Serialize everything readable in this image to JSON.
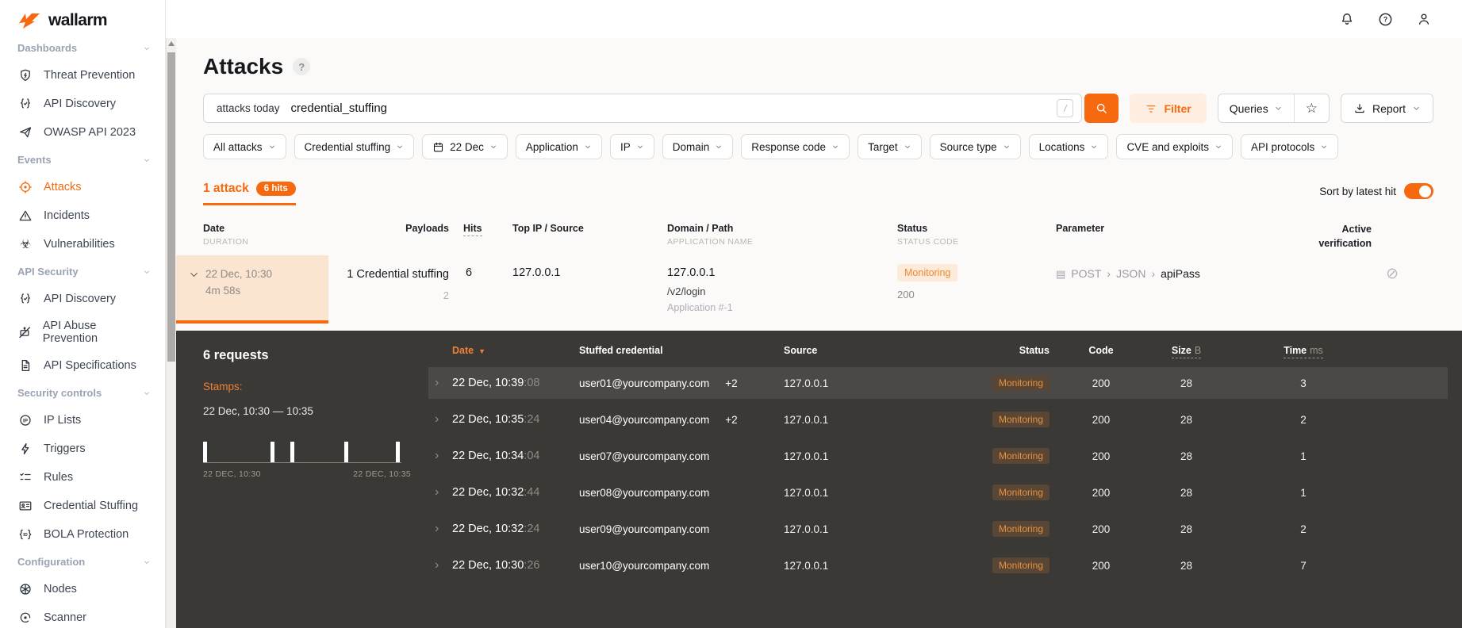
{
  "brand": {
    "name": "wallarm"
  },
  "topbar": {
    "icons": [
      "bell-icon",
      "help-icon",
      "person-icon"
    ]
  },
  "sidebar": {
    "sections": [
      {
        "label": "Dashboards",
        "items": [
          {
            "icon": "shield-icon",
            "label": "Threat Prevention"
          },
          {
            "icon": "braces-check-icon",
            "label": "API Discovery"
          },
          {
            "icon": "paper-plane-icon",
            "label": "OWASP API 2023"
          }
        ]
      },
      {
        "label": "Events",
        "items": [
          {
            "icon": "target-icon",
            "label": "Attacks"
          },
          {
            "icon": "warning-triangle-icon",
            "label": "Incidents"
          },
          {
            "icon": "biohazard-icon",
            "label": "Vulnerabilities"
          }
        ]
      },
      {
        "label": "API Security",
        "items": [
          {
            "icon": "braces-check-icon",
            "label": "API Discovery"
          },
          {
            "icon": "robot-crossed-icon",
            "label": "API Abuse Prevention"
          },
          {
            "icon": "document-icon",
            "label": "API Specifications"
          }
        ]
      },
      {
        "label": "Security controls",
        "items": [
          {
            "icon": "ip-circle-icon",
            "label": "IP Lists"
          },
          {
            "icon": "bolt-icon",
            "label": "Triggers"
          },
          {
            "icon": "checklist-icon",
            "label": "Rules"
          },
          {
            "icon": "id-card-icon",
            "label": "Credential Stuffing"
          },
          {
            "icon": "id-braces-icon",
            "label": "BOLA Protection"
          }
        ]
      },
      {
        "label": "Configuration",
        "items": [
          {
            "icon": "nodes-icon",
            "label": "Nodes"
          },
          {
            "icon": "scanner-icon",
            "label": "Scanner"
          }
        ]
      }
    ]
  },
  "page": {
    "title": "Attacks"
  },
  "search": {
    "query_primary": "attacks today",
    "query_secondary": "credential_stuffing",
    "shortcut_key": "/"
  },
  "actions": {
    "filter": "Filter",
    "queries": "Queries",
    "report": "Report"
  },
  "filters": {
    "chips": [
      {
        "label": "All attacks"
      },
      {
        "label": "Credential stuffing"
      },
      {
        "label": "22 Dec",
        "icon": "calendar-icon"
      },
      {
        "label": "Application"
      },
      {
        "label": "IP"
      },
      {
        "label": "Domain"
      },
      {
        "label": "Response code"
      },
      {
        "label": "Target"
      },
      {
        "label": "Source type"
      },
      {
        "label": "Locations"
      },
      {
        "label": "CVE and exploits"
      },
      {
        "label": "API protocols"
      }
    ]
  },
  "summary": {
    "attacks": "1 attack",
    "hits": "6 hits",
    "sort_label": "Sort by latest hit",
    "sort_on": true
  },
  "attacks_table": {
    "headers": {
      "date": "Date",
      "date_sub": "DURATION",
      "payloads": "Payloads",
      "hits": "Hits",
      "top_ip": "Top IP / Source",
      "domain": "Domain / Path",
      "domain_sub": "APPLICATION NAME",
      "status": "Status",
      "status_sub": "STATUS CODE",
      "parameter": "Parameter",
      "active_verification": "Active verification"
    },
    "row": {
      "date": "22 Dec, 10:30",
      "duration": "4m 58s",
      "payloads": "1 Credential stuffing",
      "payloads_sub": "2",
      "hits": "6",
      "top_ip": "127.0.0.1",
      "domain": "127.0.0.1",
      "path": "/v2/login",
      "application": "Application #-1",
      "status": "Monitoring",
      "status_code": "200",
      "parameter_method": "POST",
      "parameter_sep1": "›",
      "parameter_part": "JSON",
      "parameter_sep2": "›",
      "parameter_name": "apiPass"
    }
  },
  "details": {
    "title": "6 requests",
    "stamps_label": "Stamps:",
    "stamps_range": "22 Dec, 10:30 — 10:35",
    "chart_data": {
      "type": "bar",
      "title": "Request stamps timeline",
      "x_range": [
        "22 DEC, 10:30",
        "22 DEC, 10:35"
      ],
      "bars_pct": [
        0,
        34,
        44,
        71,
        97
      ],
      "label_left": "22 DEC, 10:30",
      "label_right": "22 DEC, 10:35"
    },
    "headers": {
      "date": "Date",
      "credential": "Stuffed credential",
      "source": "Source",
      "status": "Status",
      "code": "Code",
      "size": "Size",
      "size_unit": "B",
      "time": "Time",
      "time_unit": "ms"
    },
    "rows": [
      {
        "date": "22 Dec, 10:39",
        "seconds": ":08",
        "credential": "user01@yourcompany.com",
        "extra": "+2",
        "source": "127.0.0.1",
        "status": "Monitoring",
        "code": "200",
        "size": "28",
        "time": "3"
      },
      {
        "date": "22 Dec, 10:35",
        "seconds": ":24",
        "credential": "user04@yourcompany.com",
        "extra": "+2",
        "source": "127.0.0.1",
        "status": "Monitoring",
        "code": "200",
        "size": "28",
        "time": "2"
      },
      {
        "date": "22 Dec, 10:34",
        "seconds": ":04",
        "credential": "user07@yourcompany.com",
        "extra": "",
        "source": "127.0.0.1",
        "status": "Monitoring",
        "code": "200",
        "size": "28",
        "time": "1"
      },
      {
        "date": "22 Dec, 10:32",
        "seconds": ":44",
        "credential": "user08@yourcompany.com",
        "extra": "",
        "source": "127.0.0.1",
        "status": "Monitoring",
        "code": "200",
        "size": "28",
        "time": "1"
      },
      {
        "date": "22 Dec, 10:32",
        "seconds": ":24",
        "credential": "user09@yourcompany.com",
        "extra": "",
        "source": "127.0.0.1",
        "status": "Monitoring",
        "code": "200",
        "size": "28",
        "time": "2"
      },
      {
        "date": "22 Dec, 10:30",
        "seconds": ":26",
        "credential": "user10@yourcompany.com",
        "extra": "",
        "source": "127.0.0.1",
        "status": "Monitoring",
        "code": "200",
        "size": "28",
        "time": "7"
      }
    ]
  },
  "colors": {
    "accent": "#f7690e",
    "peach": "#fbe4d0",
    "dark_panel": "#3b3936",
    "monitoring_light": "#fdebd9",
    "monitoring_dark": "#594634"
  }
}
